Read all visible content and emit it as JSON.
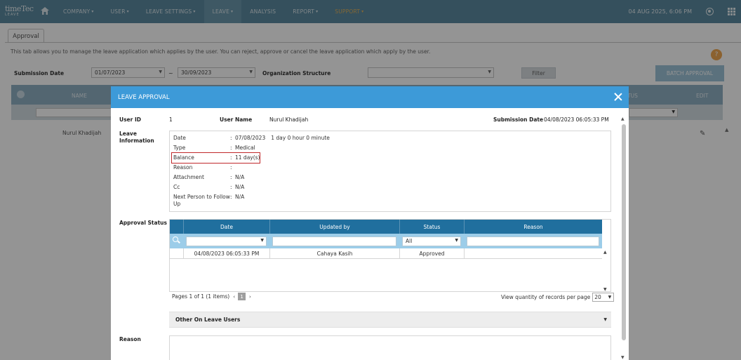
{
  "nav": {
    "logo_line1": "timeTec",
    "logo_line2": "LEAVE",
    "items": [
      {
        "label": "COMPANY",
        "caret": "▾"
      },
      {
        "label": "USER",
        "caret": "▾"
      },
      {
        "label": "LEAVE SETTINGS",
        "caret": "▾"
      },
      {
        "label": "LEAVE",
        "caret": "▾"
      },
      {
        "label": "ANALYSIS",
        "caret": ""
      },
      {
        "label": "REPORT",
        "caret": "▾"
      },
      {
        "label": "SUPPORT",
        "caret": "▾"
      }
    ],
    "datetime": "04 AUG 2025, 6:06 PM",
    "icons": {
      "home": "home-icon",
      "user": "user-circle-icon",
      "apps": "apps-grid-icon"
    }
  },
  "page": {
    "tab_label": "Approval",
    "intro": "This tab allows you to manage the leave application which applies by the user. You can reject, approve or cancel the leave application which apply by the user.",
    "submission_date_label": "Submission Date",
    "date_from": "01/07/2023",
    "date_separator": "~",
    "date_to": "30/09/2023",
    "org_label": "Organization Structure",
    "org_value": "",
    "filter_label": "Filter",
    "batch_label": "BATCH APPROVAL",
    "table": {
      "name_header": "NAME",
      "status_header_partial": "TUS",
      "edit_header": "EDIT"
    },
    "row_name": "Nurul Khadijah"
  },
  "modal": {
    "title": "LEAVE APPROVAL",
    "user_id_label": "User ID",
    "user_id": "1",
    "user_name_label": "User Name",
    "user_name": "Nurul Khadijah",
    "submission_date_label": "Submission Date",
    "submission_date": "04/08/2023 06:05:33 PM",
    "leave_info_label": "Leave Information",
    "info": {
      "date_label": "Date",
      "date_value": "07/08/2023",
      "duration": "1 day 0 hour 0 minute",
      "type_label": "Type",
      "type_value": "Medical",
      "balance_label": "Balance",
      "balance_value": "11 day(s)",
      "reason_label": "Reason",
      "reason_value": "",
      "attachment_label": "Attachment",
      "attachment_value": "N/A",
      "cc_label": "Cc",
      "cc_value": "N/A",
      "next_label": "Next Person to Follow Up",
      "next_value": "N/A",
      "colon": ":"
    },
    "approval_status_label": "Approval Status",
    "grid": {
      "headers": [
        "Date",
        "Updated by",
        "Status",
        "Reason"
      ],
      "filter_status": "All",
      "rows": [
        {
          "date": "04/08/2023 06:05:33 PM",
          "updated_by": "Cahaya Kasih",
          "status": "Approved",
          "reason": ""
        }
      ]
    },
    "pager": {
      "text": "Pages 1 of 1 (1 items)",
      "prev": "‹",
      "page": "1",
      "next": "›",
      "per_page_label": "View quantity of records per page",
      "per_page_value": "20"
    },
    "other_on_leave_label": "Other On Leave Users",
    "reason_label": "Reason"
  }
}
